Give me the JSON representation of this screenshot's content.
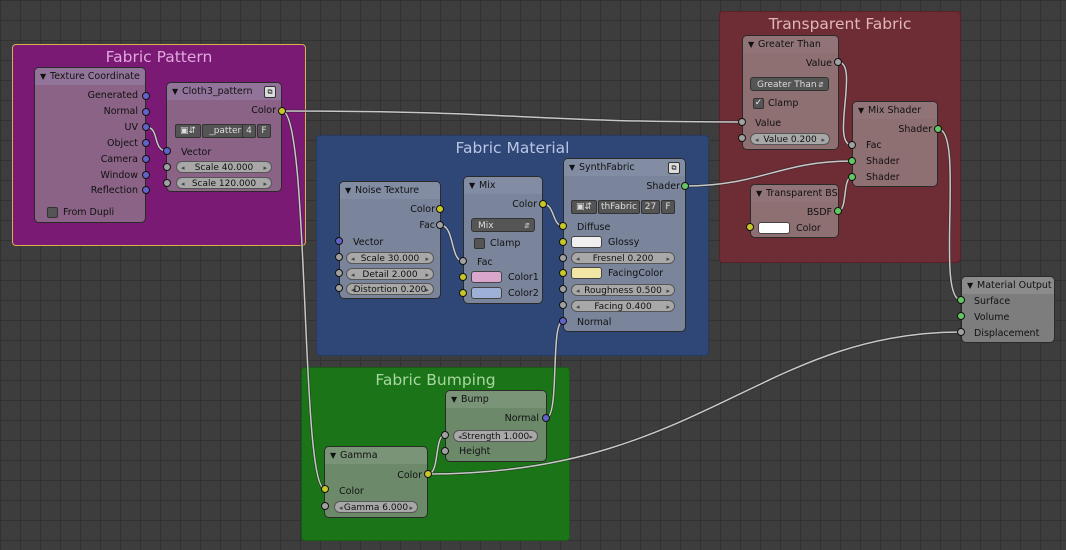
{
  "frames": {
    "fabric_pattern": "Fabric Pattern",
    "transparent_fabric": "Transparent Fabric",
    "fabric_material": "Fabric Material",
    "fabric_bumping": "Fabric Bumping"
  },
  "texture_coordinate": {
    "title": "Texture Coordinate",
    "outputs": [
      "Generated",
      "Normal",
      "UV",
      "Object",
      "Camera",
      "Window",
      "Reflection"
    ],
    "from_dupli": "From Dupli"
  },
  "cloth3_pattern": {
    "title": "Cloth3_pattern",
    "output": "Color",
    "datablock": "_pattern",
    "users": "4",
    "fake": "F",
    "vector": "Vector",
    "scale1": "Scale 40.000",
    "scale2": "Scale 120.000"
  },
  "greater_than": {
    "title": "Greater Than",
    "output": "Value",
    "operation": "Greater Than",
    "clamp": "Clamp",
    "input": "Value",
    "value_field": "Value 0.200"
  },
  "mix_shader": {
    "title": "Mix Shader",
    "output": "Shader",
    "fac": "Fac",
    "shader1": "Shader",
    "shader2": "Shader"
  },
  "transparent_bsdf": {
    "title": "Transparent BS",
    "output": "BSDF",
    "color": "Color"
  },
  "noise_texture": {
    "title": "Noise Texture",
    "out_color": "Color",
    "out_fac": "Fac",
    "vector": "Vector",
    "scale": "Scale 30.000",
    "detail": "Detail 2.000",
    "distortion": "Distortion 0.200"
  },
  "mix": {
    "title": "Mix",
    "output": "Color",
    "blend": "Mix",
    "clamp": "Clamp",
    "fac": "Fac",
    "color1": "Color1",
    "color2": "Color2"
  },
  "synth_fabric": {
    "title": "SynthFabric",
    "output": "Shader",
    "datablock": "thFabric",
    "users": "27",
    "fake": "F",
    "diffuse": "Diffuse",
    "glossy": "Glossy",
    "fresnel": "Fresnel 0.200",
    "facing_color": "FacingColor",
    "roughness": "Roughness 0.500",
    "facing": "Facing 0.400",
    "normal": "Normal"
  },
  "bump": {
    "title": "Bump",
    "output": "Normal",
    "strength": "Strength 1.000",
    "height": "Height"
  },
  "gamma": {
    "title": "Gamma",
    "output": "Color",
    "color": "Color",
    "gamma": "Gamma 6.000"
  },
  "material_output": {
    "title": "Material Output",
    "surface": "Surface",
    "volume": "Volume",
    "displacement": "Displacement"
  },
  "colors": {
    "socket_vector": "#6363c7",
    "socket_color": "#c7c729",
    "socket_shader": "#63c763",
    "socket_value": "#a1a1a1",
    "mix_color1": "#d9a6cc",
    "mix_color2": "#9eb0d6",
    "glossy_color": "#f0f0f0",
    "facing_color": "#f2e6a6",
    "transparent_color": "#ffffff"
  }
}
